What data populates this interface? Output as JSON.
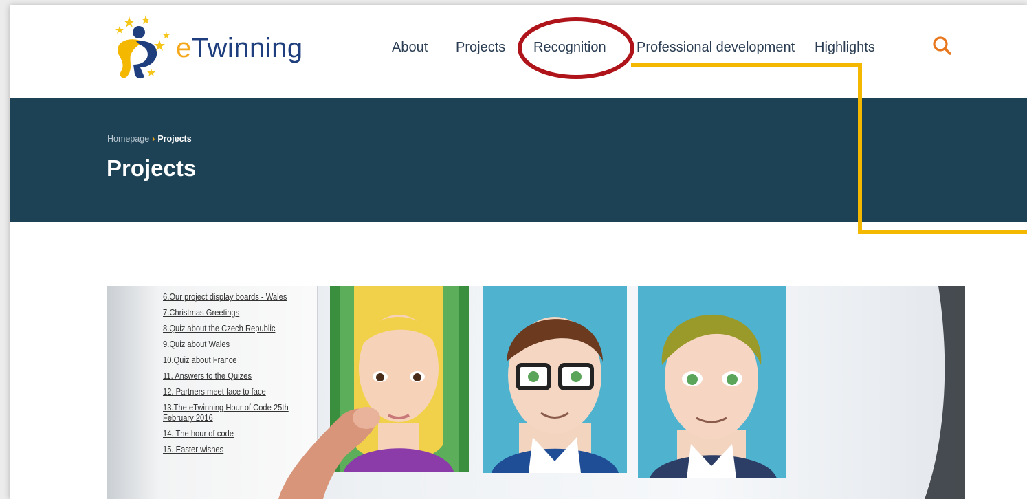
{
  "logo": {
    "prefix": "e",
    "name": "Twinning"
  },
  "nav": {
    "items": [
      {
        "label": "About"
      },
      {
        "label": "Projects"
      },
      {
        "label": "Recognition"
      },
      {
        "label": "Professional development"
      },
      {
        "label": "Highlights"
      }
    ],
    "search_icon": "search-icon"
  },
  "breadcrumb": {
    "home": "Homepage",
    "separator": "›",
    "current": "Projects"
  },
  "page_title": "Projects",
  "photo": {
    "project_list": [
      "6.Our project display boards - Wales",
      "7.Christmas Greetings",
      "8.Quiz about the Czech Republic",
      "9.Quiz about Wales",
      "10.Quiz about France",
      "11. Answers to the Quizes",
      "12. Partners meet face to face",
      "13.The eTwinning Hour of Code 25th February 2016",
      "14. The hour of code",
      "15. Easter wishes"
    ]
  },
  "annotation": {
    "highlight_color": "#b0141b",
    "connector_color": "#f5b800"
  },
  "colors": {
    "banner": "#1d4255",
    "accent": "#f5a81c",
    "nav_text": "#2a3d52"
  }
}
